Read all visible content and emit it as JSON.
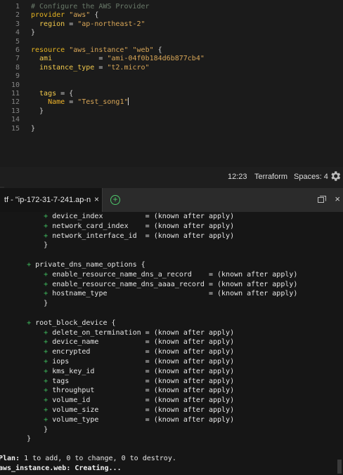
{
  "editor": {
    "lines": [
      {
        "num": "1",
        "segments": [
          {
            "t": "# Configure the AWS Provider",
            "c": "comment"
          }
        ]
      },
      {
        "num": "2",
        "segments": [
          {
            "t": "provider ",
            "c": "kw"
          },
          {
            "t": "\"aws\"",
            "c": "str"
          },
          {
            "t": " {",
            "c": "punc"
          }
        ]
      },
      {
        "num": "3",
        "segments": [
          {
            "t": "  region",
            "c": "attr"
          },
          {
            "t": " = ",
            "c": "punc"
          },
          {
            "t": "\"ap-northeast-2\"",
            "c": "str"
          }
        ]
      },
      {
        "num": "4",
        "segments": [
          {
            "t": "}",
            "c": "punc"
          }
        ]
      },
      {
        "num": "5",
        "segments": []
      },
      {
        "num": "6",
        "segments": [
          {
            "t": "resource ",
            "c": "kw"
          },
          {
            "t": "\"aws_instance\"",
            "c": "str"
          },
          {
            "t": " ",
            "c": "punc"
          },
          {
            "t": "\"web\"",
            "c": "str"
          },
          {
            "t": " {",
            "c": "punc"
          }
        ]
      },
      {
        "num": "7",
        "segments": [
          {
            "t": "  ami",
            "c": "attr"
          },
          {
            "t": "           = ",
            "c": "punc"
          },
          {
            "t": "\"ami-04f0b184d6b877cb4\"",
            "c": "str"
          }
        ]
      },
      {
        "num": "8",
        "segments": [
          {
            "t": "  instance_type",
            "c": "attr"
          },
          {
            "t": " = ",
            "c": "punc"
          },
          {
            "t": "\"t2.micro\"",
            "c": "str"
          }
        ]
      },
      {
        "num": "9",
        "segments": []
      },
      {
        "num": "10",
        "segments": []
      },
      {
        "num": "11",
        "segments": [
          {
            "t": "  tags",
            "c": "attr"
          },
          {
            "t": " = {",
            "c": "punc"
          }
        ]
      },
      {
        "num": "12",
        "segments": [
          {
            "t": "    Name",
            "c": "tag"
          },
          {
            "t": " = ",
            "c": "punc"
          },
          {
            "t": "\"Test_song1\"",
            "c": "str"
          }
        ],
        "cursor": true
      },
      {
        "num": "13",
        "segments": [
          {
            "t": "  }",
            "c": "punc"
          }
        ]
      },
      {
        "num": "14",
        "segments": []
      },
      {
        "num": "15",
        "segments": [
          {
            "t": "}",
            "c": "punc"
          }
        ]
      }
    ]
  },
  "status": {
    "time": "12:23",
    "language": "Terraform",
    "spaces": "Spaces: 4",
    "settings_icon": "gear-icon"
  },
  "terminal_tab": {
    "label": "tf - \"ip-172-31-7-241.ap-n",
    "close": "×",
    "add_icon": "plus-circle-icon",
    "maximize_icon": "maximize-icon",
    "close_panel": "×"
  },
  "terminal": {
    "lines": [
      {
        "plus": true,
        "indent": 10,
        "text": "device_index          = (known after apply)"
      },
      {
        "plus": true,
        "indent": 10,
        "text": "network_card_index    = (known after apply)"
      },
      {
        "plus": true,
        "indent": 10,
        "text": "network_interface_id  = (known after apply)"
      },
      {
        "plus": false,
        "indent": 8,
        "text": "}"
      },
      {
        "plus": false,
        "indent": 0,
        "text": ""
      },
      {
        "plus": true,
        "indent": 6,
        "text": "private_dns_name_options {"
      },
      {
        "plus": true,
        "indent": 10,
        "text": "enable_resource_name_dns_a_record    = (known after apply)"
      },
      {
        "plus": true,
        "indent": 10,
        "text": "enable_resource_name_dns_aaaa_record = (known after apply)"
      },
      {
        "plus": true,
        "indent": 10,
        "text": "hostname_type                        = (known after apply)"
      },
      {
        "plus": false,
        "indent": 8,
        "text": "}"
      },
      {
        "plus": false,
        "indent": 0,
        "text": ""
      },
      {
        "plus": true,
        "indent": 6,
        "text": "root_block_device {"
      },
      {
        "plus": true,
        "indent": 10,
        "text": "delete_on_termination = (known after apply)"
      },
      {
        "plus": true,
        "indent": 10,
        "text": "device_name           = (known after apply)"
      },
      {
        "plus": true,
        "indent": 10,
        "text": "encrypted             = (known after apply)"
      },
      {
        "plus": true,
        "indent": 10,
        "text": "iops                  = (known after apply)"
      },
      {
        "plus": true,
        "indent": 10,
        "text": "kms_key_id            = (known after apply)"
      },
      {
        "plus": true,
        "indent": 10,
        "text": "tags                  = (known after apply)"
      },
      {
        "plus": true,
        "indent": 10,
        "text": "throughput            = (known after apply)"
      },
      {
        "plus": true,
        "indent": 10,
        "text": "volume_id             = (known after apply)"
      },
      {
        "plus": true,
        "indent": 10,
        "text": "volume_size           = (known after apply)"
      },
      {
        "plus": true,
        "indent": 10,
        "text": "volume_type           = (known after apply)"
      },
      {
        "plus": false,
        "indent": 8,
        "text": "}"
      },
      {
        "plus": false,
        "indent": 4,
        "text": "}"
      },
      {
        "plus": false,
        "indent": 0,
        "text": ""
      },
      {
        "plus": false,
        "indent": 0,
        "text": "Plan: 1 to add, 0 to change, 0 to destroy.",
        "bold_prefix": "Plan:",
        "clip": true
      },
      {
        "plus": false,
        "indent": 0,
        "text": "aws_instance.web: Creating...",
        "bold": true,
        "clip": true
      }
    ]
  },
  "colors": {
    "accent_green": "#3fbf5f",
    "string": "#d8a657",
    "keyword": "#e6b422"
  }
}
